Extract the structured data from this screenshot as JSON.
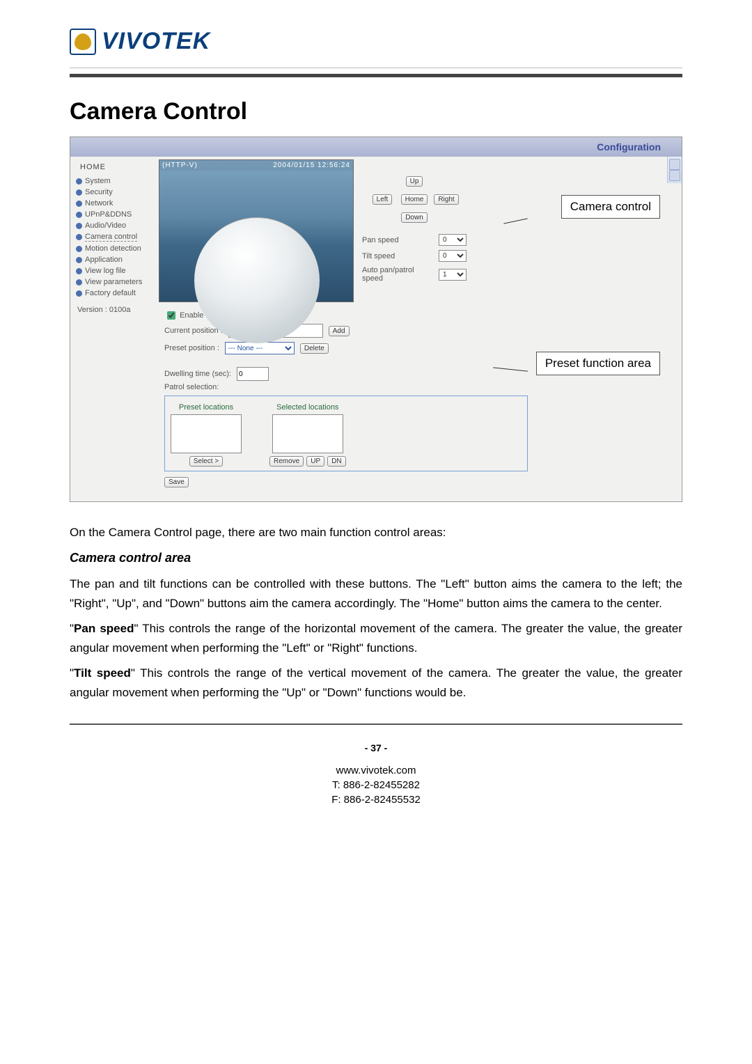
{
  "brand": {
    "name": "VIVOTEK"
  },
  "title": "Camera Control",
  "config_label": "Configuration",
  "nav": {
    "home": "HOME",
    "items": [
      "System",
      "Security",
      "Network",
      "UPnP&DDNS",
      "Audio/Video",
      "Camera control",
      "Motion detection",
      "Application",
      "View log file",
      "View parameters",
      "Factory default"
    ],
    "version": "Version : 0100a"
  },
  "preview": {
    "left_tag": "(HTTP-V)",
    "timestamp": "2004/01/15 12:56:24"
  },
  "dpad": {
    "up": "Up",
    "left": "Left",
    "home": "Home",
    "right": "Right",
    "down": "Down"
  },
  "speeds": {
    "pan_label": "Pan speed",
    "pan_value": "0",
    "tilt_label": "Tilt speed",
    "tilt_value": "0",
    "auto_label": "Auto pan/patrol speed",
    "auto_value": "1"
  },
  "preset": {
    "enable_label": "Enable IR control",
    "current_label": "Current position :",
    "add_btn": "Add",
    "preset_label": "Preset position :",
    "preset_value": "--- None ---",
    "delete_btn": "Delete",
    "dwell_label": "Dwelling time (sec):",
    "dwell_value": "0",
    "patrol_label": "Patrol selection:",
    "col1": "Preset locations",
    "col2": "Selected locations",
    "select_btn": "Select >",
    "remove_btn": "Remove",
    "up_btn": "UP",
    "dn_btn": "DN",
    "save_btn": "Save"
  },
  "annotations": {
    "camera": "Camera control",
    "preset": "Preset function area"
  },
  "body": {
    "intro": "On the Camera Control page, there are two main function control areas:",
    "sub1_title": "Camera control area",
    "sub1_p1": "The pan and tilt functions can be controlled with these buttons. The \"Left\" button aims the camera to the left; the \"Right\", \"Up\", and \"Down\" buttons aim the camera accordingly. The \"Home\" button aims the camera to the center.",
    "pan_b": "Pan speed",
    "pan_t": "\" This controls the range of the horizontal movement of the camera. The greater the value, the greater angular movement when performing the \"Left\" or \"Right\" functions.",
    "tilt_b": "Tilt speed",
    "tilt_t": "\" This controls the range of the vertical movement of the camera. The greater the value, the greater angular movement when performing the \"Up\" or \"Down\" functions would be."
  },
  "footer": {
    "page": "- 37 -",
    "url": "www.vivotek.com",
    "tel": "T: 886-2-82455282",
    "fax": "F: 886-2-82455532"
  }
}
